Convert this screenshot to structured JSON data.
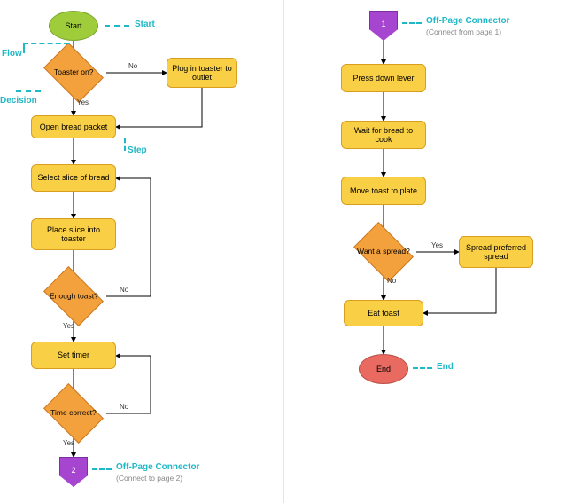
{
  "legend": {
    "start": "Start",
    "flow": "Flow",
    "decision": "Decision",
    "step": "Step",
    "off_page": "Off-Page Connector",
    "off_page_to": "(Connect to page 2)",
    "off_page_from": "(Connect from page 1)",
    "end": "End"
  },
  "left": {
    "start": "Start",
    "toaster_on": "Toaster on?",
    "plug_in": "Plug in toaster to outlet",
    "open_packet": "Open bread packet",
    "select_slice": "Select slice of bread",
    "place_slice": "Place slice into toaster",
    "enough_toast": "Enough toast?",
    "set_timer": "Set timer",
    "time_correct": "Time correct?",
    "connector": "2"
  },
  "right": {
    "connector": "1",
    "press_lever": "Press down lever",
    "wait_cook": "Wait for bread to cook",
    "move_plate": "Move toast to plate",
    "want_spread": "Want a spread?",
    "spread": "Spread preferred spread",
    "eat": "Eat toast",
    "end": "End"
  },
  "labels": {
    "yes": "Yes",
    "no": "No"
  },
  "chart_data": {
    "type": "flowchart",
    "pages": [
      {
        "nodes": [
          {
            "id": "start",
            "type": "terminator",
            "text": "Start"
          },
          {
            "id": "toaster_on",
            "type": "decision",
            "text": "Toaster on?"
          },
          {
            "id": "plug_in",
            "type": "process",
            "text": "Plug in toaster to outlet"
          },
          {
            "id": "open_packet",
            "type": "process",
            "text": "Open bread packet"
          },
          {
            "id": "select_slice",
            "type": "process",
            "text": "Select slice of bread"
          },
          {
            "id": "place_slice",
            "type": "process",
            "text": "Place slice into toaster"
          },
          {
            "id": "enough_toast",
            "type": "decision",
            "text": "Enough toast?"
          },
          {
            "id": "set_timer",
            "type": "process",
            "text": "Set timer"
          },
          {
            "id": "time_correct",
            "type": "decision",
            "text": "Time correct?"
          },
          {
            "id": "off2",
            "type": "offpage",
            "text": "2"
          }
        ],
        "edges": [
          {
            "from": "start",
            "to": "toaster_on"
          },
          {
            "from": "toaster_on",
            "to": "plug_in",
            "label": "No"
          },
          {
            "from": "toaster_on",
            "to": "open_packet",
            "label": "Yes"
          },
          {
            "from": "plug_in",
            "to": "open_packet"
          },
          {
            "from": "open_packet",
            "to": "select_slice"
          },
          {
            "from": "select_slice",
            "to": "place_slice"
          },
          {
            "from": "place_slice",
            "to": "enough_toast"
          },
          {
            "from": "enough_toast",
            "to": "select_slice",
            "label": "No"
          },
          {
            "from": "enough_toast",
            "to": "set_timer",
            "label": "Yes"
          },
          {
            "from": "set_timer",
            "to": "time_correct"
          },
          {
            "from": "time_correct",
            "to": "set_timer",
            "label": "No"
          },
          {
            "from": "time_correct",
            "to": "off2",
            "label": "Yes"
          }
        ]
      },
      {
        "nodes": [
          {
            "id": "off1",
            "type": "offpage",
            "text": "1"
          },
          {
            "id": "press_lever",
            "type": "process",
            "text": "Press down lever"
          },
          {
            "id": "wait_cook",
            "type": "process",
            "text": "Wait for bread to cook"
          },
          {
            "id": "move_plate",
            "type": "process",
            "text": "Move toast to plate"
          },
          {
            "id": "want_spread",
            "type": "decision",
            "text": "Want a spread?"
          },
          {
            "id": "spread",
            "type": "process",
            "text": "Spread preferred spread"
          },
          {
            "id": "eat",
            "type": "process",
            "text": "Eat toast"
          },
          {
            "id": "end",
            "type": "terminator",
            "text": "End"
          }
        ],
        "edges": [
          {
            "from": "off1",
            "to": "press_lever"
          },
          {
            "from": "press_lever",
            "to": "wait_cook"
          },
          {
            "from": "wait_cook",
            "to": "move_plate"
          },
          {
            "from": "move_plate",
            "to": "want_spread"
          },
          {
            "from": "want_spread",
            "to": "spread",
            "label": "Yes"
          },
          {
            "from": "want_spread",
            "to": "eat",
            "label": "No"
          },
          {
            "from": "spread",
            "to": "eat"
          },
          {
            "from": "eat",
            "to": "end"
          }
        ]
      }
    ]
  }
}
